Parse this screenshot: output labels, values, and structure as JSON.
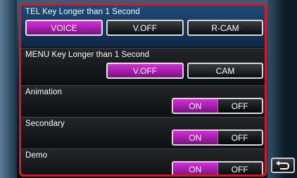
{
  "settings": [
    {
      "label": "TEL Key Longer than 1 Second",
      "options": [
        "VOICE",
        "V.OFF",
        "R-CAM"
      ],
      "selected": "VOICE"
    },
    {
      "label": "MENU Key Longer than 1 Second",
      "options": [
        "V.OFF",
        "CAM"
      ],
      "selected": "V.OFF"
    },
    {
      "label": "Animation",
      "on_label": "ON",
      "off_label": "OFF",
      "value": "ON"
    },
    {
      "label": "Secondary",
      "on_label": "ON",
      "off_label": "OFF",
      "value": "ON"
    },
    {
      "label": "Demo",
      "on_label": "ON",
      "off_label": "OFF",
      "value": "ON"
    }
  ],
  "colors": {
    "accent_selected": "#b61fbf",
    "highlight_border": "#d71a22",
    "top_section": "#1f4a78"
  },
  "icons": {
    "back": "return-arrow-icon"
  }
}
